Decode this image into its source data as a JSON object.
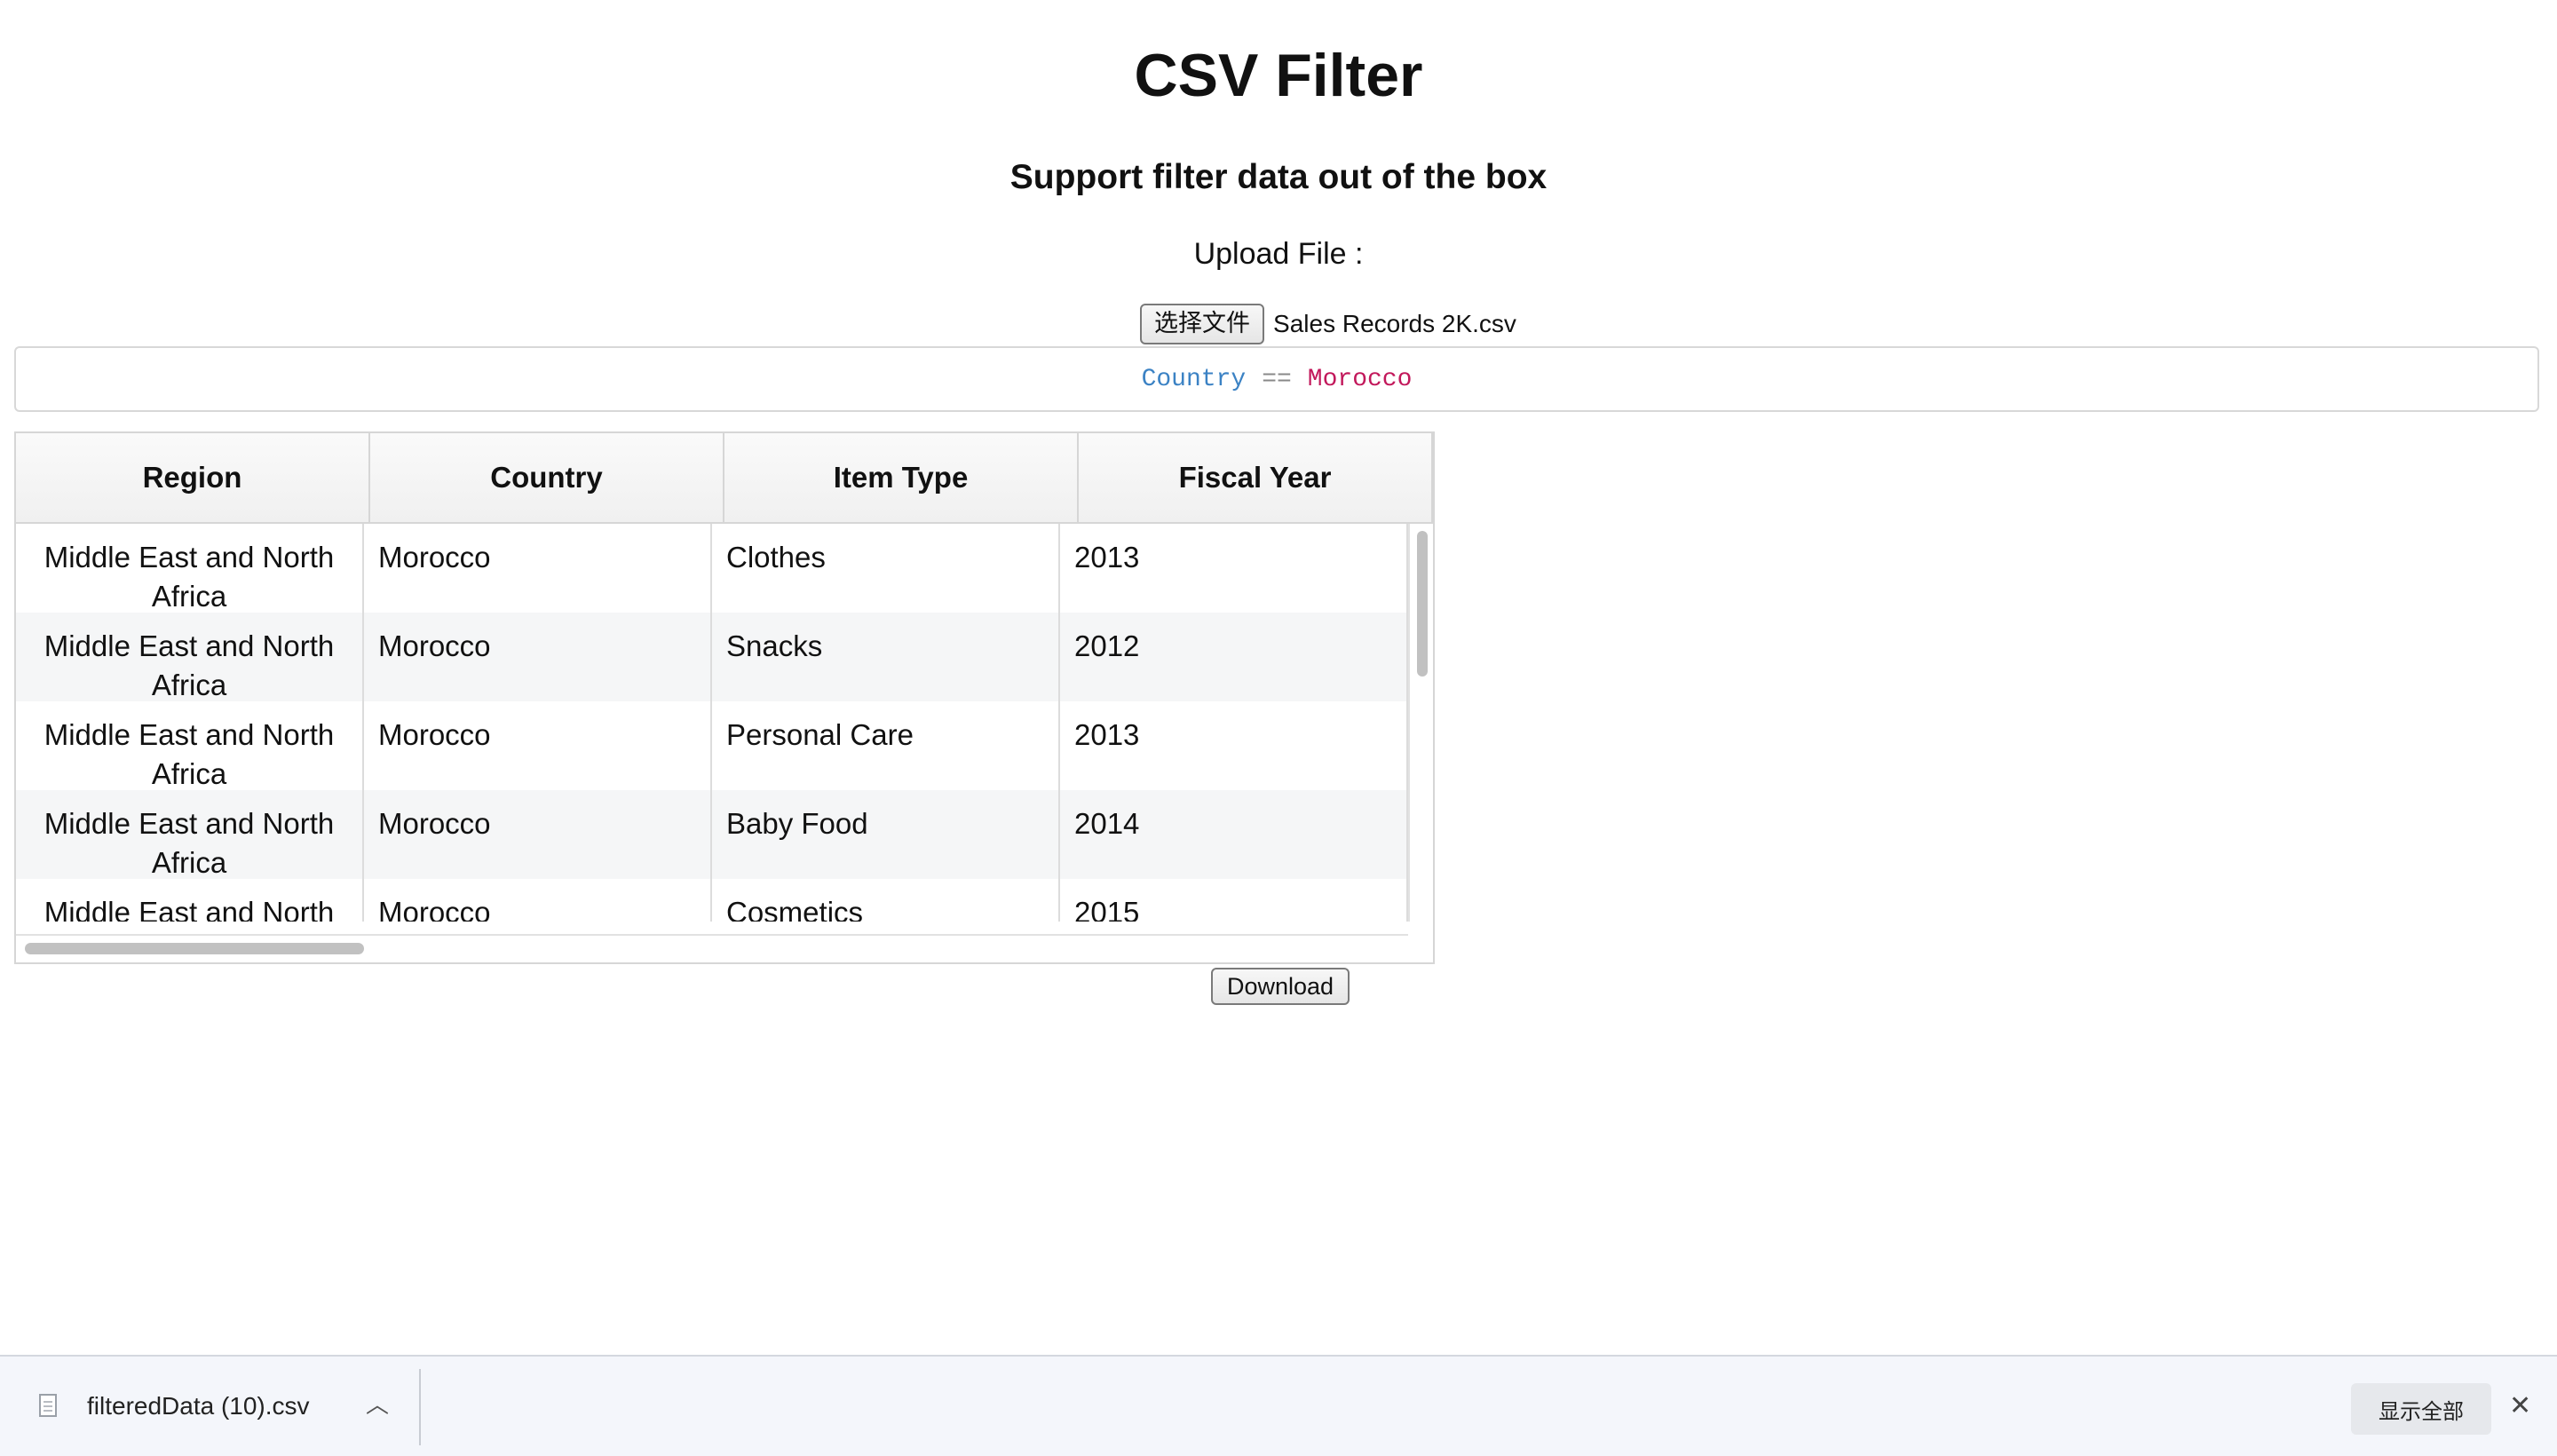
{
  "header": {
    "title": "CSV Filter",
    "subtitle": "Support filter data out of the box",
    "upload_label": "Upload File :"
  },
  "file_input": {
    "button_label": "选择文件",
    "file_name": "Sales Records 2K.csv"
  },
  "filter": {
    "field": "Country",
    "operator": "==",
    "value": "Morocco"
  },
  "table": {
    "columns": [
      "Region",
      "Country",
      "Item Type",
      "Fiscal Year"
    ],
    "rows": [
      {
        "region": "Middle East and North Africa",
        "country": "Morocco",
        "item_type": "Clothes",
        "fiscal_year": "2013"
      },
      {
        "region": "Middle East and North Africa",
        "country": "Morocco",
        "item_type": "Snacks",
        "fiscal_year": "2012"
      },
      {
        "region": "Middle East and North Africa",
        "country": "Morocco",
        "item_type": "Personal Care",
        "fiscal_year": "2013"
      },
      {
        "region": "Middle East and North Africa",
        "country": "Morocco",
        "item_type": "Baby Food",
        "fiscal_year": "2014"
      },
      {
        "region": "Middle East and North",
        "country": "Morocco",
        "item_type": "Cosmetics",
        "fiscal_year": "2015"
      }
    ]
  },
  "actions": {
    "download_label": "Download"
  },
  "download_bar": {
    "file_name": "filteredData (10).csv",
    "chevron_icon": "chevron-up-icon",
    "show_all_label": "显示全部",
    "close_icon": "close-icon"
  },
  "colors": {
    "filter_field": "#3b82c4",
    "filter_value": "#c2185b",
    "alt_row": "#f5f6f7"
  }
}
